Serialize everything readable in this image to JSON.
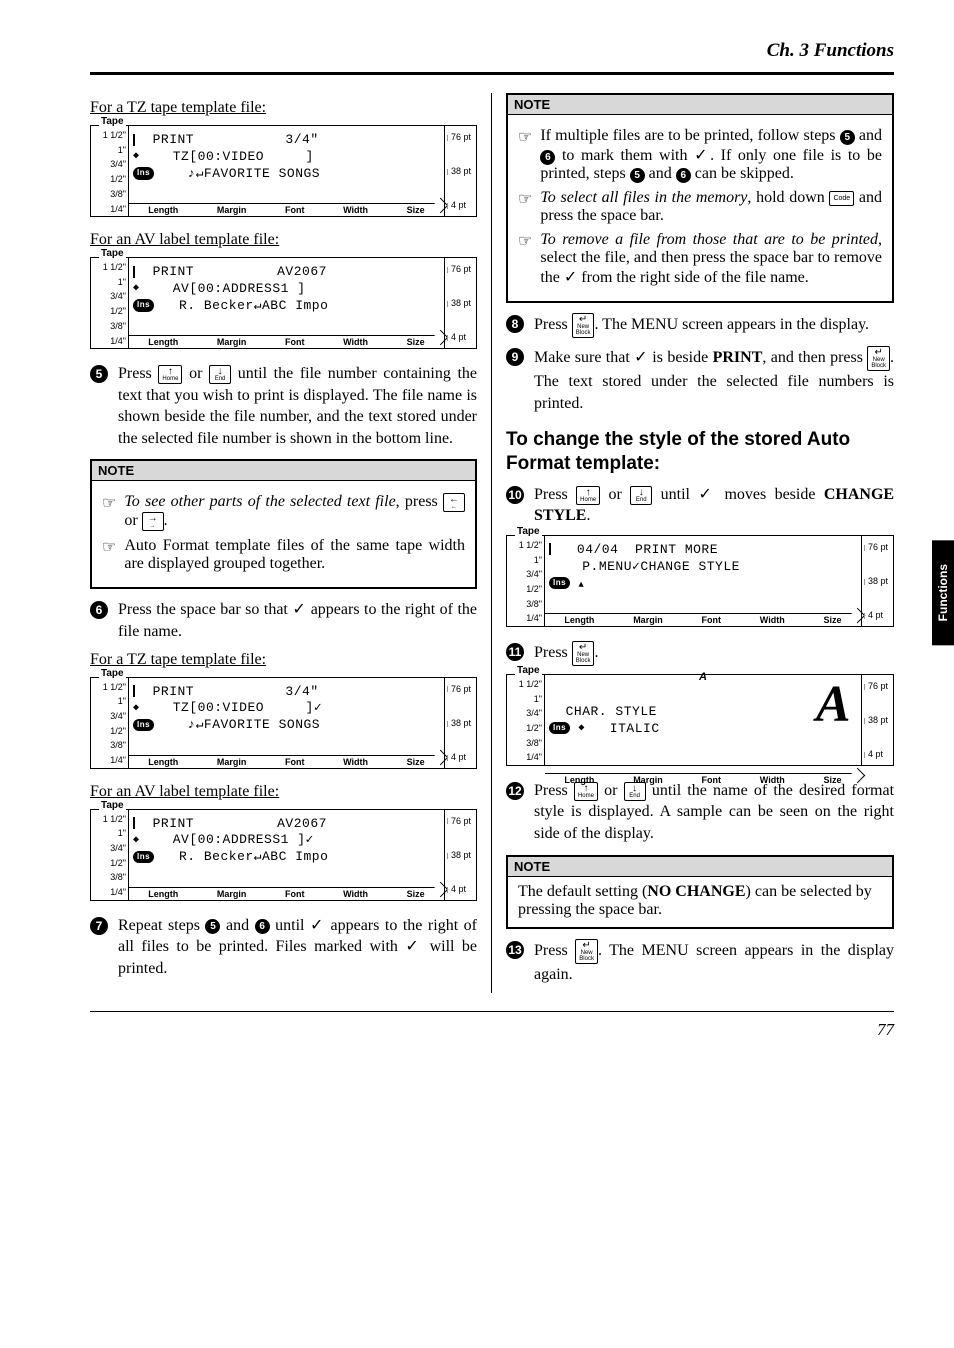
{
  "header": "Ch. 3 Functions",
  "side_tab": "Functions",
  "page_number": "77",
  "subheads": {
    "tz1": "For a TZ tape template file:",
    "av1": "For an AV label template file:",
    "tz2": "For a TZ tape template file:",
    "av2": "For an AV label template file:"
  },
  "lcd_common": {
    "tape": "Tape",
    "ins": "Ins",
    "sizes": [
      "1 1/2\"",
      "1\"",
      "3/4\"",
      "1/2\"",
      "3/8\"",
      "1/4\""
    ],
    "pts": [
      "76 pt",
      "38 pt",
      "4 pt"
    ],
    "footer": [
      "Length",
      "Margin",
      "Font",
      "Width",
      "Size"
    ]
  },
  "lcd1": {
    "l1": "  PRINT           3/4\"",
    "l2": "    TZ[00:VIDEO     ]",
    "l3": "    ♪↵FAVORITE SONGS"
  },
  "lcd2": {
    "l1": "  PRINT          AV2067",
    "l2": "    AV[00:ADDRESS1 ]",
    "l3": "   R. Becker↵ABC Impo"
  },
  "lcd3": {
    "l1": "  PRINT           3/4\"",
    "l2": "    TZ[00:VIDEO     ]✓",
    "l3": "    ♪↵FAVORITE SONGS"
  },
  "lcd4": {
    "l1": "  PRINT          AV2067",
    "l2": "    AV[00:ADDRESS1 ]✓",
    "l3": "   R. Becker↵ABC Impo"
  },
  "lcd5": {
    "l1": "   04/04  PRINT MORE",
    "l2": "   P.MENU✓CHANGE STYLE",
    "l3": "   "
  },
  "lcd6": {
    "a_label": "A",
    "l1": "  CHAR. STYLE",
    "l2": "   ITALIC",
    "big_a": "A"
  },
  "steps": {
    "s5": "until the file number containing the text that you wish to print is displayed. The file name is shown beside the file number, and the text stored under the selected file number is shown in the bottom line.",
    "s6": "Press the space bar so that ✓ appears to the right of the file name.",
    "s7a": "Repeat steps ",
    "s7b": " and ",
    "s7c": " until ✓ appears to the right of all files to be printed. Files marked with ✓ will be printed.",
    "s8": ". The MENU screen appears in the display.",
    "s9a": "Make sure that ✓ is beside ",
    "s9b": ", and then press ",
    "s9c": ". The text stored under the selected file numbers is printed.",
    "s10a": "until ✓ moves beside ",
    "s11": ".",
    "s12": "until the name of the desired format style is displayed. A sample can be seen on the right side of the display.",
    "s13": ". The MENU screen appears in the display again."
  },
  "labels": {
    "press": "Press",
    "or": "or",
    "print_word": "PRINT",
    "change_style": "CHANGE STYLE"
  },
  "keys": {
    "home": "Home",
    "end": "End",
    "code": "Code",
    "newblock": "New\nBlock",
    "left": "←",
    "right": "→",
    "up": "↑",
    "down": "↓",
    "enter": "↵"
  },
  "note1": {
    "i1a": "To see other parts of the selected text file",
    "i1b": ", press ",
    "i2": "Auto Format template files of the same tape width are displayed grouped together."
  },
  "note2": {
    "i1a": "If multiple files are to be printed, follow steps ",
    "i1b": " and ",
    "i1c": " to mark them with ✓. If only one file is to be printed, steps ",
    "i1d": " and ",
    "i1e": " can be skipped.",
    "i2a": "To select all files in the memory",
    "i2b": ", hold down ",
    "i2c": " and press the space bar.",
    "i3a": "To remove a file from those that are to be printed",
    "i3b": ", select the file, and then press the space bar to remove the ✓ from the right side of the file name."
  },
  "note3": {
    "text_a": "The default setting (",
    "text_b": "NO CHANGE",
    "text_c": ") can be selected by pressing the space bar."
  },
  "section_title": "To change the style of the stored Auto Format template:",
  "note_head": "NOTE"
}
